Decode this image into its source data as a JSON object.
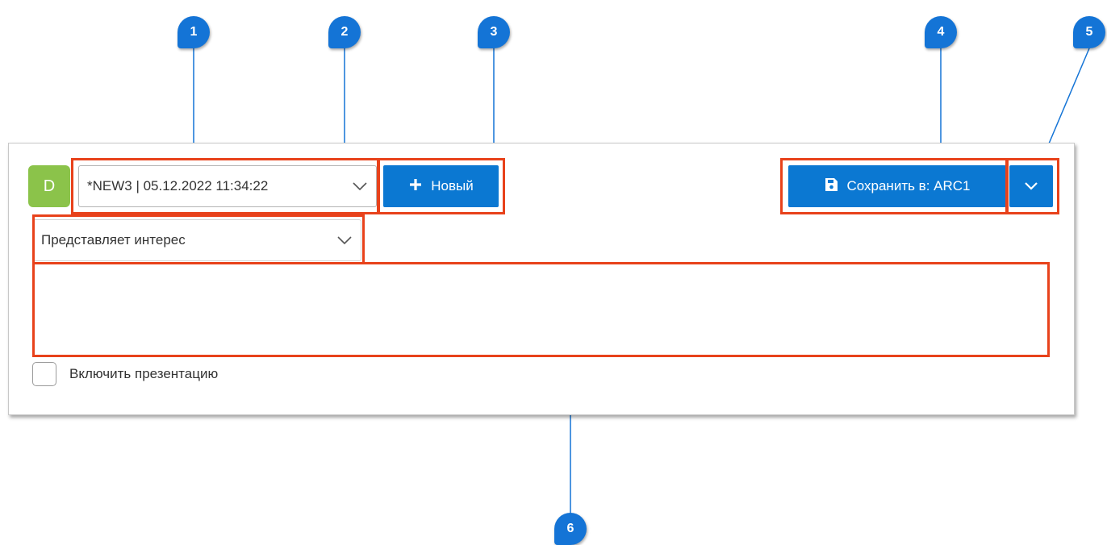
{
  "toolbar": {
    "avatar_letter": "D",
    "version_select": "*NEW3 | 05.12.2022 11:34:22",
    "new_button": "Новый",
    "save_button": "Сохранить в: ARC1"
  },
  "form": {
    "type_select": "Представляет интерес",
    "comment_value": "",
    "presentation_checkbox_label": "Включить презентацию",
    "presentation_checked": false
  },
  "callouts": [
    "1",
    "2",
    "3",
    "4",
    "5",
    "6"
  ],
  "colors": {
    "accent": "#0b78d2",
    "avatar": "#8bc34a",
    "highlight": "#e8421b",
    "callout": "#1474d6"
  },
  "icons": {
    "new_button_icon": "plus-icon",
    "save_button_icon": "floppy-disk-icon",
    "dropdown_icon": "chevron-down-icon"
  }
}
